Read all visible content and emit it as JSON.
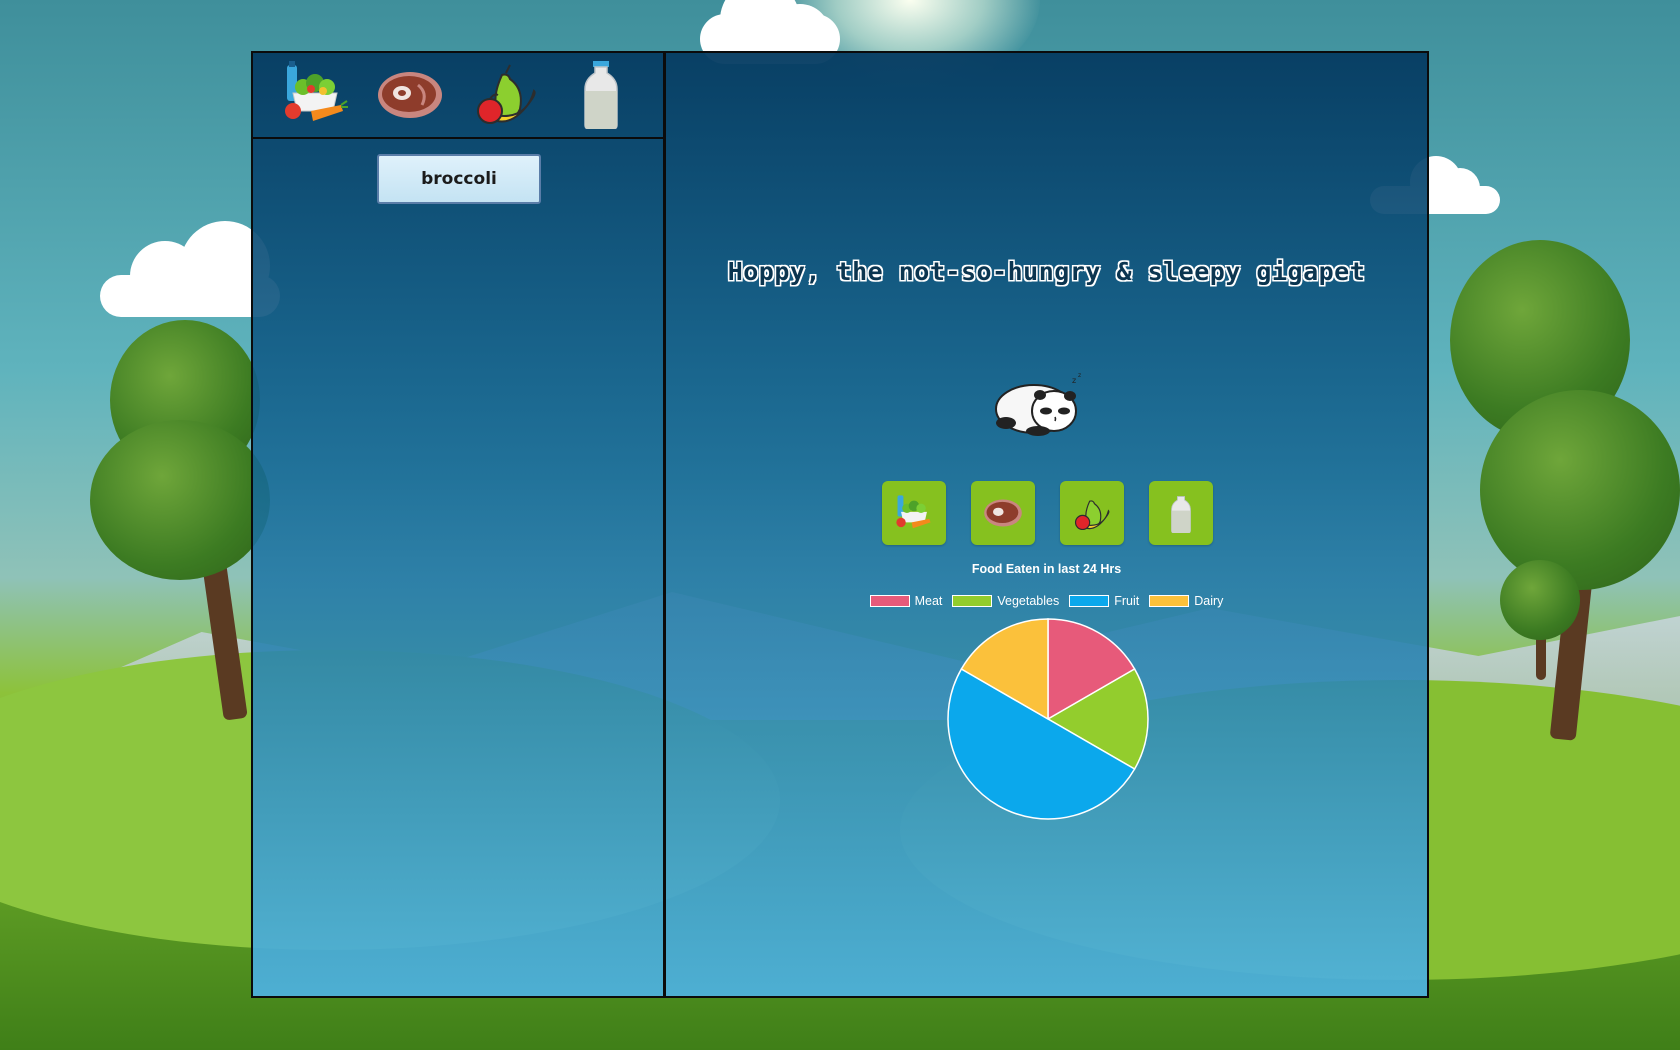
{
  "app": {
    "pet_title": "Hoppy, the not-so-hungry & sleepy gigapet"
  },
  "food_tabs": [
    {
      "icon": "vegetables-icon",
      "category": "Vegetables"
    },
    {
      "icon": "meat-icon",
      "category": "Meat"
    },
    {
      "icon": "fruit-icon",
      "category": "Fruit"
    },
    {
      "icon": "dairy-icon",
      "category": "Dairy"
    }
  ],
  "food_list": {
    "items": [
      "broccoli"
    ]
  },
  "pet": {
    "avatar": "sleeping-panda-icon"
  },
  "feed_buttons": [
    {
      "icon": "vegetables-icon"
    },
    {
      "icon": "meat-icon"
    },
    {
      "icon": "fruit-icon"
    },
    {
      "icon": "dairy-icon"
    }
  ],
  "colors": {
    "meat": "#e75a7a",
    "vegetables": "#93cd2d",
    "fruit": "#0ba8ec",
    "dairy": "#fbc13b",
    "feed_button_bg": "#86c11f"
  },
  "chart_data": {
    "type": "pie",
    "title": "Food Eaten in last 24 Hrs",
    "legend_position": "top",
    "categories": [
      "Meat",
      "Vegetables",
      "Fruit",
      "Dairy"
    ],
    "values": [
      1,
      1,
      3,
      1
    ],
    "colors": [
      "#e75a7a",
      "#93cd2d",
      "#0ba8ec",
      "#fbc13b"
    ]
  }
}
